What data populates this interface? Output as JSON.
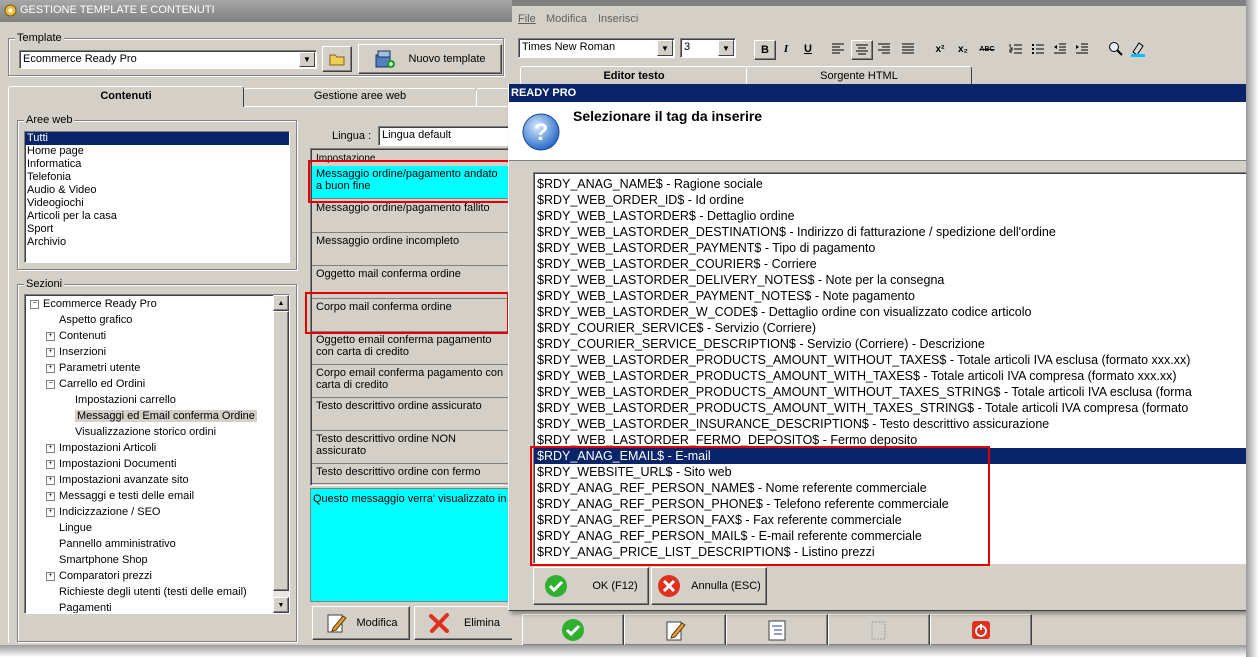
{
  "left_window": {
    "title": "GESTIONE TEMPLATE E CONTENUTI",
    "template_group_label": "Template",
    "template_value": "Ecommerce Ready Pro",
    "new_template_label": "Nuovo template",
    "tabs": [
      {
        "label": "Contenuti"
      },
      {
        "label": "Gestione aree web"
      }
    ],
    "aree_label": "Aree web",
    "aree_items": [
      "Tutti",
      "Home page",
      "Informatica",
      "Telefonia",
      "Audio & Video",
      "Videogiochi",
      "Articoli per la casa",
      "Sport",
      "Archivio"
    ],
    "lingua_label": "Lingua :",
    "lingua_value": "Lingua default",
    "messages_header": "Impostazione",
    "messages": [
      "Messaggio ordine/pagamento andato a buon fine",
      "Messaggio ordine/pagamento fallito",
      "Messaggio ordine incompleto",
      "Oggetto mail conferma ordine",
      "Corpo mail conferma ordine",
      "Oggetto email conferma pagamento con carta di credito",
      "Corpo email conferma pagamento con carta di credito",
      "Testo descrittivo ordine assicurato",
      "Testo descrittivo ordine NON assicurato",
      "Testo descrittivo ordine con fermo"
    ],
    "preview_text": "Questo messaggio verra' visualizzato in",
    "sezioni_label": "Sezioni",
    "tree": [
      {
        "label": "Ecommerce Ready Pro",
        "level": 0,
        "exp": "−"
      },
      {
        "label": "Aspetto grafico",
        "level": 1,
        "exp": ""
      },
      {
        "label": "Contenuti",
        "level": 1,
        "exp": "+"
      },
      {
        "label": "Inserzioni",
        "level": 1,
        "exp": "+"
      },
      {
        "label": "Parametri utente",
        "level": 1,
        "exp": "+"
      },
      {
        "label": "Carrello ed Ordini",
        "level": 1,
        "exp": "−"
      },
      {
        "label": "Impostazioni carrello",
        "level": 2,
        "exp": ""
      },
      {
        "label": "Messaggi ed Email conferma Ordine",
        "level": 2,
        "exp": "",
        "selected": true
      },
      {
        "label": "Visualizzazione storico ordini",
        "level": 2,
        "exp": ""
      },
      {
        "label": "Impostazioni Articoli",
        "level": 1,
        "exp": "+"
      },
      {
        "label": "Impostazioni Documenti",
        "level": 1,
        "exp": "+"
      },
      {
        "label": "Impostazioni avanzate sito",
        "level": 1,
        "exp": "+"
      },
      {
        "label": "Messaggi e testi delle email",
        "level": 1,
        "exp": "+"
      },
      {
        "label": "Indicizzazione / SEO",
        "level": 1,
        "exp": "+"
      },
      {
        "label": "Lingue",
        "level": 1,
        "exp": ""
      },
      {
        "label": "Pannello amministrativo",
        "level": 1,
        "exp": ""
      },
      {
        "label": "Smartphone Shop",
        "level": 1,
        "exp": ""
      },
      {
        "label": "Comparatori prezzi",
        "level": 1,
        "exp": "+"
      },
      {
        "label": "Richieste degli utenti (testi delle email)",
        "level": 1,
        "exp": ""
      },
      {
        "label": "Pagamenti",
        "level": 1,
        "exp": ""
      }
    ],
    "modifica_label": "Modifica",
    "elimina_label": "Elimina"
  },
  "editor_window": {
    "menu": [
      "File",
      "Modifica",
      "Inserisci"
    ],
    "font_value": "Times New Roman",
    "size_value": "3",
    "tabs": [
      {
        "label": "Editor testo"
      },
      {
        "label": "Sorgente HTML"
      }
    ],
    "toolbar_glyphs": {
      "bold": "B",
      "italic": "I",
      "underline": "U",
      "sup": "x²",
      "sub": "x₂",
      "abc": "ABC"
    }
  },
  "dialog": {
    "title": "READY PRO",
    "prompt": "Selezionare il tag da inserire",
    "tags": [
      {
        "code": "$RDY_ANAG_NAME$",
        "desc": "Ragione sociale"
      },
      {
        "code": "$RDY_WEB_ORDER_ID$",
        "desc": "Id ordine"
      },
      {
        "code": "$RDY_WEB_LASTORDER$",
        "desc": "Dettaglio ordine"
      },
      {
        "code": "$RDY_WEB_LASTORDER_DESTINATION$",
        "desc": "Indirizzo di fatturazione / spedizione dell'ordine"
      },
      {
        "code": "$RDY_WEB_LASTORDER_PAYMENT$",
        "desc": "Tipo di pagamento"
      },
      {
        "code": "$RDY_WEB_LASTORDER_COURIER$",
        "desc": "Corriere"
      },
      {
        "code": "$RDY_WEB_LASTORDER_DELIVERY_NOTES$",
        "desc": "Note per la consegna"
      },
      {
        "code": "$RDY_WEB_LASTORDER_PAYMENT_NOTES$",
        "desc": "Note pagamento"
      },
      {
        "code": "$RDY_WEB_LASTORDER_W_CODE$",
        "desc": "Dettaglio ordine con visualizzato codice articolo"
      },
      {
        "code": "$RDY_COURIER_SERVICE$",
        "desc": "Servizio (Corriere)"
      },
      {
        "code": "$RDY_COURIER_SERVICE_DESCRIPTION$",
        "desc": "Servizio (Corriere) - Descrizione"
      },
      {
        "code": "$RDY_WEB_LASTORDER_PRODUCTS_AMOUNT_WITHOUT_TAXES$",
        "desc": "Totale articoli IVA esclusa (formato xxx.xx)"
      },
      {
        "code": "$RDY_WEB_LASTORDER_PRODUCTS_AMOUNT_WITH_TAXES$",
        "desc": "Totale articoli IVA compresa (formato xxx.xx)"
      },
      {
        "code": "$RDY_WEB_LASTORDER_PRODUCTS_AMOUNT_WITHOUT_TAXES_STRING$",
        "desc": "Totale articoli IVA esclusa (forma"
      },
      {
        "code": "$RDY_WEB_LASTORDER_PRODUCTS_AMOUNT_WITH_TAXES_STRING$",
        "desc": "Totale articoli IVA compresa (formato"
      },
      {
        "code": "$RDY_WEB_LASTORDER_INSURANCE_DESCRIPTION$",
        "desc": "Testo descrittivo assicurazione"
      },
      {
        "code": "$RDY_WEB_LASTORDER_FERMO_DEPOSITO$",
        "desc": "Fermo deposito"
      },
      {
        "code": "$RDY_ANAG_EMAIL$",
        "desc": "E-mail",
        "selected": true
      },
      {
        "code": "$RDY_WEBSITE_URL$",
        "desc": "Sito web"
      },
      {
        "code": "$RDY_ANAG_REF_PERSON_NAME$",
        "desc": "Nome referente commerciale"
      },
      {
        "code": "$RDY_ANAG_REF_PERSON_PHONE$",
        "desc": "Telefono referente commerciale"
      },
      {
        "code": "$RDY_ANAG_REF_PERSON_FAX$",
        "desc": "Fax referente commerciale"
      },
      {
        "code": "$RDY_ANAG_REF_PERSON_MAIL$",
        "desc": "E-mail referente commerciale"
      },
      {
        "code": "$RDY_ANAG_PRICE_LIST_DESCRIPTION$",
        "desc": "Listino prezzi"
      }
    ],
    "separator": " - ",
    "ok_label": "OK (F12)",
    "cancel_label": "Annulla (ESC)"
  },
  "colors": {
    "window_bg": "#d4d0c8",
    "title_bar": "#0a246a",
    "selection": "#0a246a",
    "cyan_highlight": "#00ffff",
    "annotation_red": "#e00000",
    "inactive_title": "#808080"
  }
}
